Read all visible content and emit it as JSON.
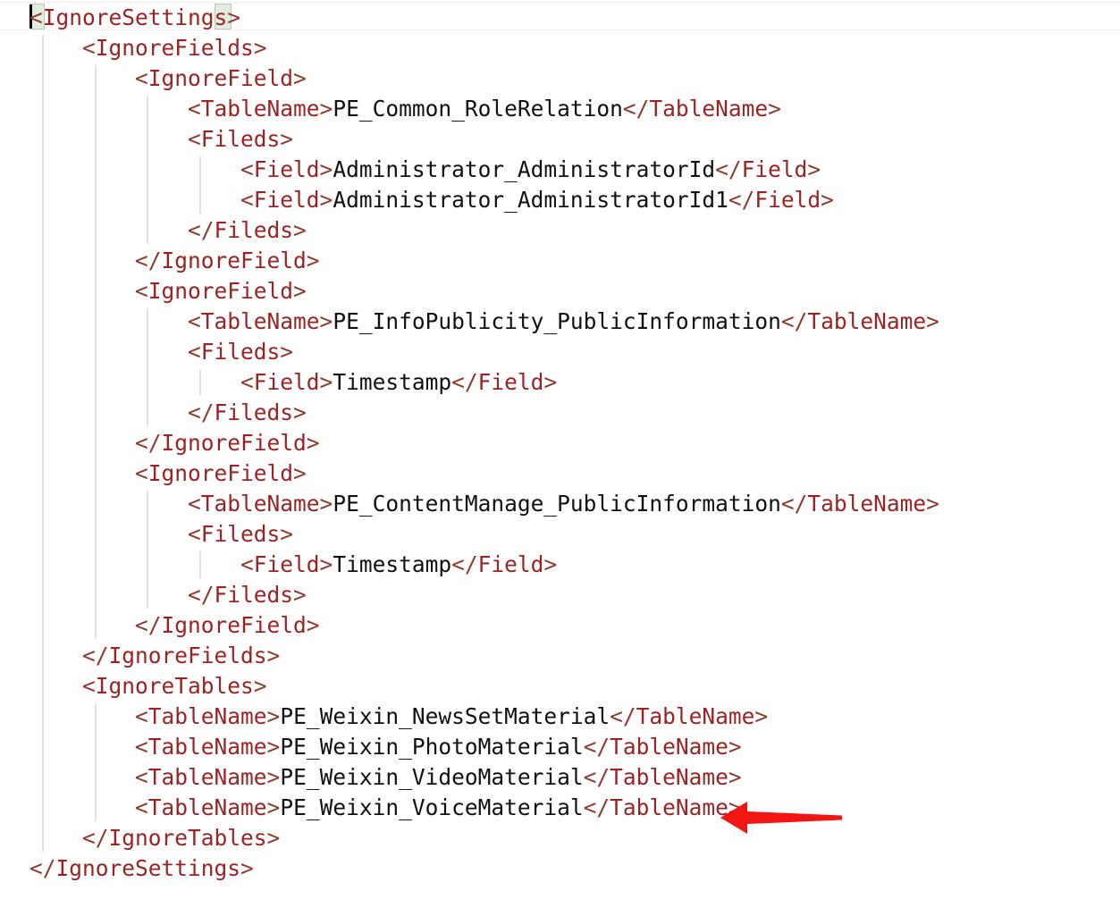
{
  "editor": {
    "language": "xml",
    "background_color": "#ffffff",
    "tag_color": "#9b2323",
    "bracket_color": "#8f3b2e",
    "text_color": "#111111",
    "indent_guide_color": "#e0e0e0",
    "bracket_match_highlight_color": "#e2ece0",
    "caret_color": "#000000",
    "line_height_px": 34,
    "font_size_px": 24.5
  },
  "annotation": {
    "arrow": {
      "icon": "left-arrow-icon",
      "color": "#f31414",
      "direction": "left",
      "points_at_line": 24
    }
  },
  "code": {
    "lines": [
      {
        "n": 1,
        "indent": 0,
        "type": "open",
        "tag": "IgnoreSettings",
        "text": "",
        "full": "<IgnoreSettings>"
      },
      {
        "n": 2,
        "indent": 1,
        "type": "open",
        "tag": "IgnoreFields",
        "text": "",
        "full": "<IgnoreFields>"
      },
      {
        "n": 3,
        "indent": 2,
        "type": "open",
        "tag": "IgnoreField",
        "text": "",
        "full": "<IgnoreField>"
      },
      {
        "n": 4,
        "indent": 3,
        "type": "pair",
        "tag": "TableName",
        "text": "PE_Common_RoleRelation",
        "full": "<TableName>PE_Common_RoleRelation</TableName>"
      },
      {
        "n": 5,
        "indent": 3,
        "type": "open",
        "tag": "Fileds",
        "text": "",
        "full": "<Fileds>"
      },
      {
        "n": 6,
        "indent": 4,
        "type": "pair",
        "tag": "Field",
        "text": "Administrator_AdministratorId",
        "full": "<Field>Administrator_AdministratorId</Field>"
      },
      {
        "n": 7,
        "indent": 4,
        "type": "pair",
        "tag": "Field",
        "text": "Administrator_AdministratorId1",
        "full": "<Field>Administrator_AdministratorId1</Field>"
      },
      {
        "n": 8,
        "indent": 3,
        "type": "close",
        "tag": "Fileds",
        "text": "",
        "full": "</Fileds>"
      },
      {
        "n": 9,
        "indent": 2,
        "type": "close",
        "tag": "IgnoreField",
        "text": "",
        "full": "</IgnoreField>"
      },
      {
        "n": 10,
        "indent": 2,
        "type": "open",
        "tag": "IgnoreField",
        "text": "",
        "full": "<IgnoreField>"
      },
      {
        "n": 11,
        "indent": 3,
        "type": "pair",
        "tag": "TableName",
        "text": "PE_InfoPublicity_PublicInformation",
        "full": "<TableName>PE_InfoPublicity_PublicInformation</TableName>"
      },
      {
        "n": 12,
        "indent": 3,
        "type": "open",
        "tag": "Fileds",
        "text": "",
        "full": "<Fileds>"
      },
      {
        "n": 13,
        "indent": 4,
        "type": "pair",
        "tag": "Field",
        "text": "Timestamp",
        "full": "<Field>Timestamp</Field>"
      },
      {
        "n": 14,
        "indent": 3,
        "type": "close",
        "tag": "Fileds",
        "text": "",
        "full": "</Fileds>"
      },
      {
        "n": 15,
        "indent": 2,
        "type": "close",
        "tag": "IgnoreField",
        "text": "",
        "full": "</IgnoreField>"
      },
      {
        "n": 16,
        "indent": 2,
        "type": "open",
        "tag": "IgnoreField",
        "text": "",
        "full": "<IgnoreField>"
      },
      {
        "n": 17,
        "indent": 3,
        "type": "pair",
        "tag": "TableName",
        "text": "PE_ContentManage_PublicInformation",
        "full": "<TableName>PE_ContentManage_PublicInformation</TableName>"
      },
      {
        "n": 18,
        "indent": 3,
        "type": "open",
        "tag": "Fileds",
        "text": "",
        "full": "<Fileds>"
      },
      {
        "n": 19,
        "indent": 4,
        "type": "pair",
        "tag": "Field",
        "text": "Timestamp",
        "full": "<Field>Timestamp</Field>"
      },
      {
        "n": 20,
        "indent": 3,
        "type": "close",
        "tag": "Fileds",
        "text": "",
        "full": "</Fileds>"
      },
      {
        "n": 21,
        "indent": 2,
        "type": "close",
        "tag": "IgnoreField",
        "text": "",
        "full": "</IgnoreField>"
      },
      {
        "n": 22,
        "indent": 1,
        "type": "close",
        "tag": "IgnoreFields",
        "text": "",
        "full": "</IgnoreFields>"
      },
      {
        "n": 23,
        "indent": 1,
        "type": "open",
        "tag": "IgnoreTables",
        "text": "",
        "full": "<IgnoreTables>"
      },
      {
        "n": 24,
        "indent": 2,
        "type": "pair",
        "tag": "TableName",
        "text": "PE_Weixin_NewsSetMaterial",
        "full": "<TableName>PE_Weixin_NewsSetMaterial</TableName>"
      },
      {
        "n": 25,
        "indent": 2,
        "type": "pair",
        "tag": "TableName",
        "text": "PE_Weixin_PhotoMaterial",
        "full": "<TableName>PE_Weixin_PhotoMaterial</TableName>"
      },
      {
        "n": 26,
        "indent": 2,
        "type": "pair",
        "tag": "TableName",
        "text": "PE_Weixin_VideoMaterial",
        "full": "<TableName>PE_Weixin_VideoMaterial</TableName>"
      },
      {
        "n": 27,
        "indent": 2,
        "type": "pair",
        "tag": "TableName",
        "text": "PE_Weixin_VoiceMaterial",
        "full": "<TableName>PE_Weixin_VoiceMaterial</TableName>"
      },
      {
        "n": 28,
        "indent": 1,
        "type": "close",
        "tag": "IgnoreTables",
        "text": "",
        "full": "</IgnoreTables>"
      },
      {
        "n": 29,
        "indent": 0,
        "type": "close",
        "tag": "IgnoreSettings",
        "text": "",
        "full": "</IgnoreSettings>"
      }
    ]
  }
}
